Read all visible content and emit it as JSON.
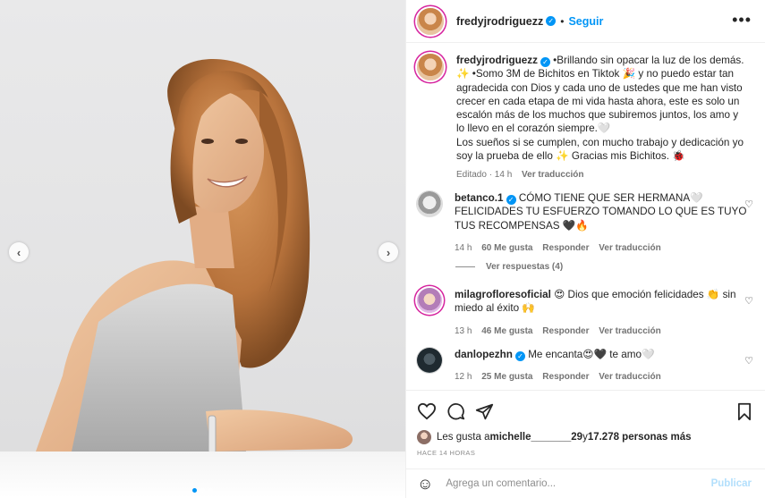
{
  "post": {
    "author": "fredyjrodriguezz",
    "follow_label": "Seguir",
    "separator": "•",
    "more_label": "•••"
  },
  "caption": {
    "username": "fredyjrodriguezz",
    "text_1": "•Brillando sin opacar la luz de los demás. ✨ •Somo 3M de Bichitos en Tiktok 🎉 y no puedo estar tan agradecida con Dios y cada uno de ustedes que me han visto crecer en cada etapa de mi vida hasta ahora, este es solo un escalón más de los muchos que subiremos juntos, los amo y lo llevo en el corazón siempre.🤍",
    "text_2": "Los sueños si se cumplen, con mucho trabajo y dedicación yo soy la prueba de ello ✨ Gracias mis Bichitos. 🐞",
    "edited": "Editado · 14 h",
    "translate": "Ver traducción"
  },
  "comments": [
    {
      "username": "betanco.1",
      "text": "CÓMO TIENE QUE SER HERMANA🤍 FELICIDADES TU ESFUERZO TOMANDO LO QUE ES TUYO TUS RECOMPENSAS 🖤🔥",
      "time": "14 h",
      "likes": "60 Me gusta",
      "reply": "Responder",
      "translate": "Ver traducción",
      "view_replies": "Ver respuestas (4)"
    },
    {
      "username": "milagrofloresoficial",
      "text": "😍 Dios que emoción felicidades 👏 sin miedo al éxito 🙌",
      "time": "13 h",
      "likes": "46 Me gusta",
      "reply": "Responder",
      "translate": "Ver traducción"
    },
    {
      "username": "danlopezhn",
      "text": "Me encanta😍🖤 te amo🤍",
      "time": "12 h",
      "likes": "25 Me gusta",
      "reply": "Responder",
      "translate": "Ver traducción"
    }
  ],
  "likes": {
    "prefix": "Les gusta a ",
    "user": "michelle_______29",
    "middle": " y ",
    "count": "17.278 personas más"
  },
  "time_ago": "HACE 14 HORAS",
  "composer": {
    "placeholder": "Agrega un comentario...",
    "publish": "Publicar"
  },
  "icons": {
    "prev": "chevron-left-icon",
    "next": "chevron-right-icon",
    "like": "heart-icon",
    "comment": "comment-bubble-icon",
    "share": "paper-plane-icon",
    "save": "bookmark-icon",
    "emoji": "smiley-icon"
  },
  "colors": {
    "accent": "#0095f6",
    "publish_disabled": "#b2dffc",
    "story_ring": "#d6249f"
  }
}
